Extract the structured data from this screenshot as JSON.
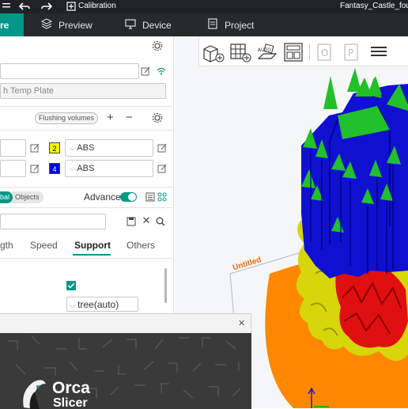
{
  "titlebar": {
    "title": "Calibration",
    "filename": "Fantasy_Castle_four_c"
  },
  "tabs": [
    {
      "label": "re",
      "active": true
    },
    {
      "label": "Preview",
      "active": false
    },
    {
      "label": "Device",
      "active": false
    },
    {
      "label": "Project",
      "active": false
    }
  ],
  "printer": {
    "plate_value": "h Temp Plate"
  },
  "filament": {
    "flushing_label": "Flushing volumes",
    "rows": [
      {
        "slot": "2",
        "color": "#f5f500",
        "text_color": "#000000",
        "type": "ABS"
      },
      {
        "slot": "4",
        "color": "#0000ee",
        "text_color": "#ffffff",
        "type": "ABS"
      }
    ]
  },
  "process": {
    "toggle_left": "bal",
    "toggle_right": "Objects",
    "advance_label": "Advance",
    "tabs": [
      "gth",
      "Speed",
      "Support",
      "Others"
    ],
    "active_tab": "Support",
    "support_type_value": "tree(auto)"
  },
  "viewport": {
    "plate_label": "Untitled"
  },
  "splash": {
    "brand_line1": "Orca",
    "brand_line2": "Slicer"
  },
  "colors": {
    "accent": "#009688",
    "model_blue": "#1010d0",
    "model_green": "#22c02a",
    "model_yellow": "#d6d60a",
    "model_red": "#e01010",
    "plate_orange": "#ff8800"
  }
}
